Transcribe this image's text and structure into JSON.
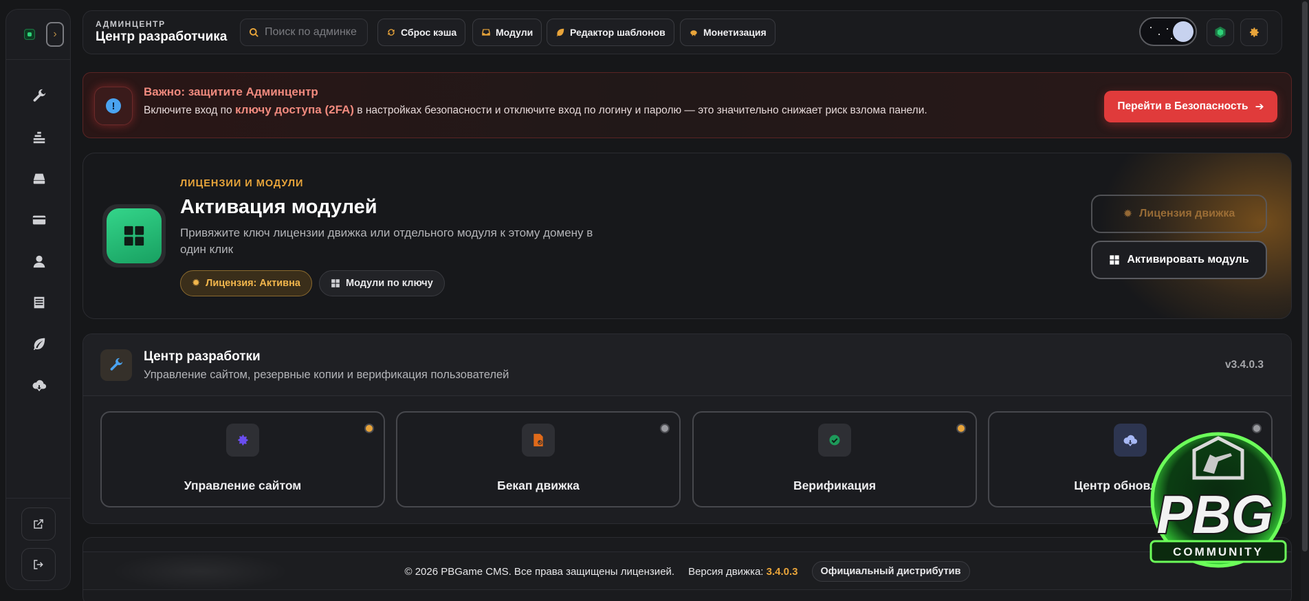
{
  "header": {
    "overline": "АДМИНЦЕНТР",
    "title": "Центр разработчика",
    "search_placeholder": "Поиск по админке",
    "buttons": [
      {
        "label": "Сброс кэша",
        "icon": "refresh-icon"
      },
      {
        "label": "Модули",
        "icon": "inbox-icon"
      },
      {
        "label": "Редактор шаблонов",
        "icon": "leaf-icon"
      },
      {
        "label": "Монетизация",
        "icon": "piggy-bank-icon"
      }
    ]
  },
  "alert": {
    "title": "Важно: защитите Админцентр",
    "text_before": "Включите вход по ",
    "text_strong": "ключу доступа (2FA)",
    "text_after": " в настройках безопасности и отключите вход по логину и паролю — это значительно снижает риск взлома панели.",
    "button_label": "Перейти в Безопасность"
  },
  "license": {
    "overline": "ЛИЦЕНЗИИ И МОДУЛИ",
    "title": "Активация модулей",
    "description": "Привяжите ключ лицензии движка или отдельного модуля к этому домену в один клик",
    "badge_status": "Лицензия: Активна",
    "badge_modules": "Модули по ключу",
    "btn_engine": "Лицензия движка",
    "btn_module": "Активировать модуль"
  },
  "dev_center": {
    "title": "Центр разработки",
    "subtitle": "Управление сайтом, резервные копии и верификация пользователей",
    "version": "v3.4.0.3",
    "tiles": [
      {
        "label": "Управление сайтом",
        "icon": "gear-icon",
        "status_color": "#e8a43a"
      },
      {
        "label": "Бекап движка",
        "icon": "file-backup-icon",
        "status_color": "#9a9ba0"
      },
      {
        "label": "Верификация",
        "icon": "check-circle-icon",
        "status_color": "#e8a43a"
      },
      {
        "label": "Центр обновлений",
        "icon": "cloud-download-icon",
        "status_color": "#9a9ba0"
      }
    ]
  },
  "footer": {
    "copyright": "© 2026 PBGame CMS. Все права защищены лицензией.",
    "version_label": "Версия движка:",
    "version_value": "3.4.0.3",
    "badge": "Официальный дистрибутив"
  },
  "watermark": {
    "text_main": "PBG",
    "text_sub": "COMMUNITY"
  },
  "colors": {
    "accent_orange": "#e8a43a",
    "danger": "#e03b3b",
    "success": "#2fd27a",
    "background": "#161719"
  }
}
